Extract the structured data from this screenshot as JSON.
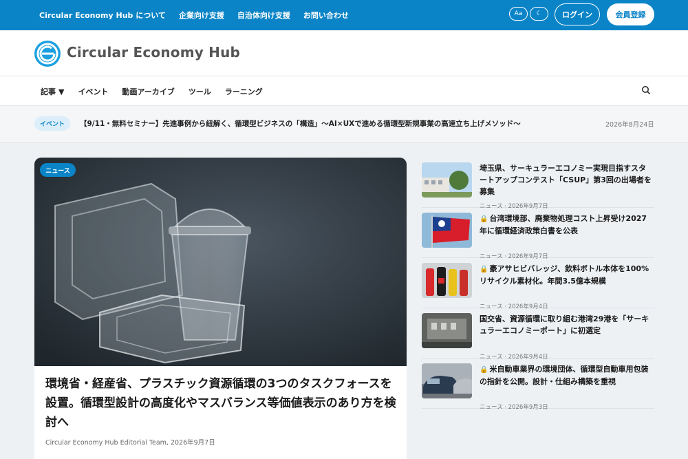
{
  "topbar": {
    "nav": [
      "Circular Economy Hub について",
      "企業向け支援",
      "自治体向け支援",
      "お問い合わせ"
    ],
    "font_toggle": "Aa",
    "theme_toggle": "☾",
    "login": "ログイン",
    "signup": "会員登録",
    "color": "#0a84c7"
  },
  "brand": {
    "name": "Circular Economy Hub"
  },
  "mainnav": {
    "items": [
      "記事",
      "イベント",
      "動画アーカイブ",
      "ツール",
      "ラーニング"
    ]
  },
  "ticker": {
    "badge": "イベント",
    "text": "【9/11・無料セミナー】先進事例から紐解く、循環型ビジネスの「構造」〜AI×UXで進める循環型新規事業の高速立ち上げメソッド〜",
    "date": "2026年8月24日"
  },
  "featured": {
    "badge": "ニュース",
    "title": "環境省・経産省、プラスチック資源循環の3つのタスクフォースを設置。循環型設計の高度化やマスバランス等価値表示のあり方を検討へ",
    "meta": "Circular Economy Hub Editorial Team, 2026年9月7日"
  },
  "side": [
    {
      "locked": false,
      "title": "埼玉県、サーキュラーエコノミー実現目指すスタートアップコンテスト「CSUP」第3回の出場者を募集",
      "meta": "ニュース · 2026年9月7日"
    },
    {
      "locked": true,
      "title": "台湾環境部、廃棄物処理コスト上昇受け2027年に循環経済政策白書を公表",
      "meta": "ニュース · 2026年9月7日"
    },
    {
      "locked": true,
      "title": "豪アサヒビバレッジ、飲料ボトル本体を100%リサイクル素材化。年間3.5億本規模",
      "meta": "ニュース · 2026年9月4日"
    },
    {
      "locked": false,
      "title": "国交省、資源循環に取り組む港湾29港を「サーキュラーエコノミーポート」に初選定",
      "meta": "ニュース · 2026年9月4日"
    },
    {
      "locked": true,
      "title": "米自動車業界の環境団体、循環型自動車用包装の指針を公開。設計・仕組み構築を重視",
      "meta": "ニュース · 2026年9月3日"
    }
  ]
}
